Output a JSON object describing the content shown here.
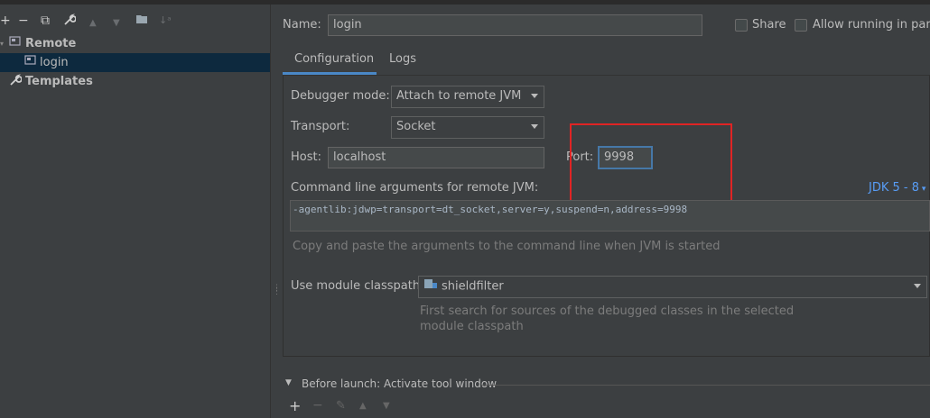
{
  "toolbar": {
    "add": "+",
    "remove": "−",
    "copy": "⧉",
    "wrench": "🔧",
    "up": "▲",
    "down": "▼",
    "folder": "▰",
    "sort": "↓ᵃ"
  },
  "tree": {
    "remote_label": "Remote",
    "login_label": "login",
    "templates_label": "Templates"
  },
  "config": {
    "name_label": "Name:",
    "name_value": "login",
    "share_label": "Share",
    "allow_parallel_label": "Allow running in parall"
  },
  "tabs": {
    "configuration": "Configuration",
    "logs": "Logs"
  },
  "debugger": {
    "mode_label": "Debugger mode:",
    "mode_value": "Attach to remote JVM",
    "transport_label": "Transport:",
    "transport_value": "Socket",
    "host_label": "Host:",
    "host_value": "localhost",
    "port_label": "Port:",
    "port_value": "9998",
    "cmd_label": "Command line arguments for remote JVM:",
    "jdk_label": "JDK 5 - 8",
    "cmd_value": "-agentlib:jdwp=transport=dt_socket,server=y,suspend=n,address=9998",
    "cmd_hint": "Copy and paste the arguments to the command line when JVM is started",
    "classpath_label": "Use module classpath:",
    "classpath_value": "shieldfilter",
    "classpath_hint_1": "First search for sources of the debugged classes in the selected",
    "classpath_hint_2": "module classpath"
  },
  "before_launch": {
    "label": "Before launch: Activate tool window",
    "add": "+",
    "remove": "−",
    "edit": "✎",
    "up": "▲",
    "down": "▼"
  },
  "colors": {
    "accent": "#4a88c7",
    "highlight": "#e02424",
    "selection": "#0d293e"
  }
}
